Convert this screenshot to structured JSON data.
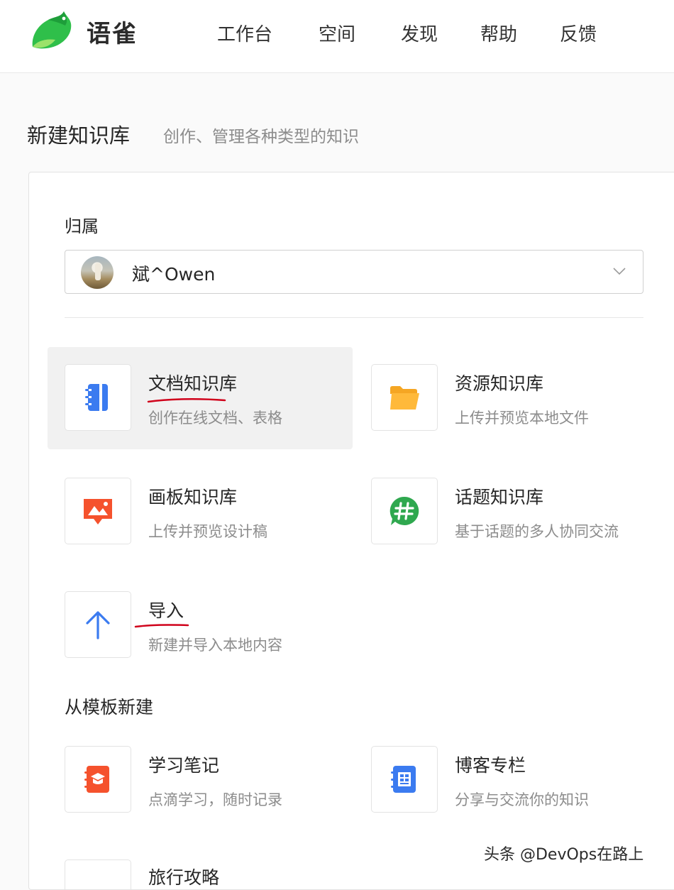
{
  "app": {
    "name": "语雀"
  },
  "nav": [
    "工作台",
    "空间",
    "发现",
    "帮助",
    "反馈"
  ],
  "page": {
    "title": "新建知识库",
    "subtitle": "创作、管理各种类型的知识"
  },
  "owner": {
    "label": "归属",
    "name": "斌^Owen"
  },
  "repo_types": [
    {
      "title": "文档知识库",
      "desc": "创作在线文档、表格",
      "icon": "notebook-icon",
      "color": "#3b7bf0"
    },
    {
      "title": "资源知识库",
      "desc": "上传并预览本地文件",
      "icon": "folder-icon",
      "color": "#f5a623"
    },
    {
      "title": "画板知识库",
      "desc": "上传并预览设计稿",
      "icon": "drawing-board-icon",
      "color": "#f5522d"
    },
    {
      "title": "话题知识库",
      "desc": "基于话题的多人协同交流",
      "icon": "hashtag-chat-icon",
      "color": "#2fa84f"
    },
    {
      "title": "导入",
      "desc": "新建并导入本地内容",
      "icon": "upload-arrow-icon",
      "color": "#3b7bf0"
    }
  ],
  "templates_section": {
    "title": "从模板新建"
  },
  "templates": [
    {
      "title": "学习笔记",
      "desc": "点滴学习，随时记录",
      "icon": "study-notes-icon",
      "color": "#f5522d"
    },
    {
      "title": "博客专栏",
      "desc": "分享与交流你的知识",
      "icon": "blog-icon",
      "color": "#3b7bf0"
    },
    {
      "title": "旅行攻略",
      "desc": "",
      "icon": "travel-icon"
    }
  ],
  "annotation_color": "#d0021b",
  "watermark": "头条 @DevOps在路上"
}
